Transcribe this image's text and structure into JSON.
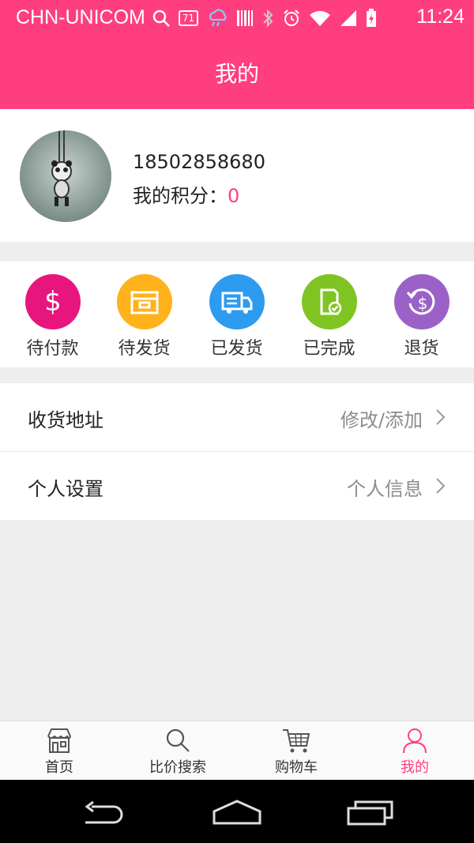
{
  "status_bar": {
    "carrier": "CHN-UNICOM",
    "badge": "71",
    "time": "11:24"
  },
  "header": {
    "title": "我的"
  },
  "profile": {
    "phone": "18502858680",
    "points_label": "我的积分：",
    "points_value": "0"
  },
  "orders": [
    {
      "label": "待付款",
      "icon": "dollar-icon",
      "color": "#e8157f"
    },
    {
      "label": "待发货",
      "icon": "box-icon",
      "color": "#ffb21b"
    },
    {
      "label": "已发货",
      "icon": "truck-icon",
      "color": "#2d9bf0"
    },
    {
      "label": "已完成",
      "icon": "check-document-icon",
      "color": "#80c423"
    },
    {
      "label": "退货",
      "icon": "refund-icon",
      "color": "#9a62c8"
    }
  ],
  "menu": [
    {
      "label": "收货地址",
      "value": "修改/添加"
    },
    {
      "label": "个人设置",
      "value": "个人信息"
    }
  ],
  "tabs": [
    {
      "label": "首页",
      "icon": "store-icon"
    },
    {
      "label": "比价搜索",
      "icon": "search-icon"
    },
    {
      "label": "购物车",
      "icon": "cart-icon"
    },
    {
      "label": "我的",
      "icon": "person-icon",
      "active": true
    }
  ],
  "colors": {
    "accent": "#ff3e7f"
  }
}
